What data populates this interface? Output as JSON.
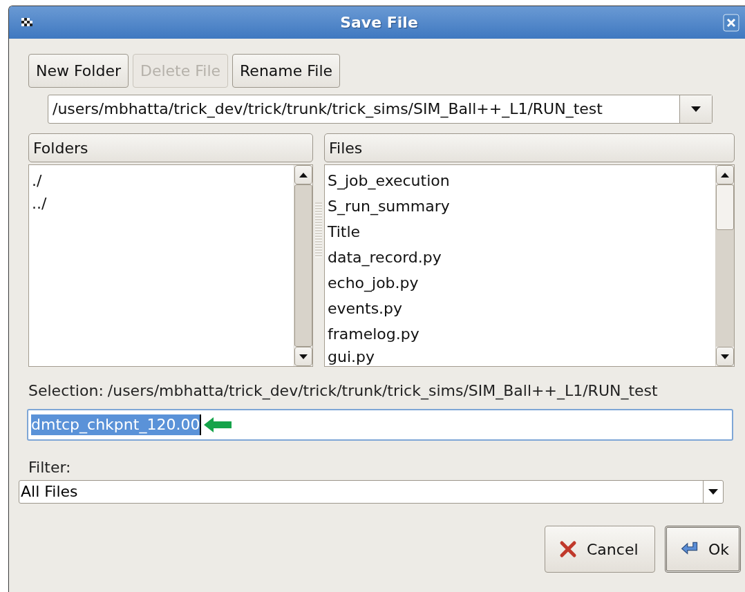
{
  "window": {
    "title": "Save File"
  },
  "toolbar": [
    {
      "label": "New Folder",
      "disabled": false
    },
    {
      "label": "Delete File",
      "disabled": true
    },
    {
      "label": "Rename File",
      "disabled": false
    }
  ],
  "path_combo": {
    "value": "/users/mbhatta/trick_dev/trick/trunk/trick_sims/SIM_Ball++_L1/RUN_test"
  },
  "folders": {
    "header": "Folders",
    "items": [
      "./",
      "../"
    ]
  },
  "files": {
    "header": "Files",
    "items": [
      "S_job_execution",
      "S_run_summary",
      "Title",
      "data_record.py",
      "echo_job.py",
      "events.py",
      "framelog.py",
      "gui.py"
    ]
  },
  "selection": {
    "label": "Selection:",
    "path": "/users/mbhatta/trick_dev/trick/trunk/trick_sims/SIM_Ball++_L1/RUN_test"
  },
  "filename": {
    "value": "dmtcp_chkpnt_120.00",
    "selected": true
  },
  "filter": {
    "label": "Filter:",
    "value": "All Files"
  },
  "buttons": [
    {
      "label": "Cancel",
      "kind": "cancel"
    },
    {
      "label": "Ok",
      "kind": "ok"
    }
  ]
}
